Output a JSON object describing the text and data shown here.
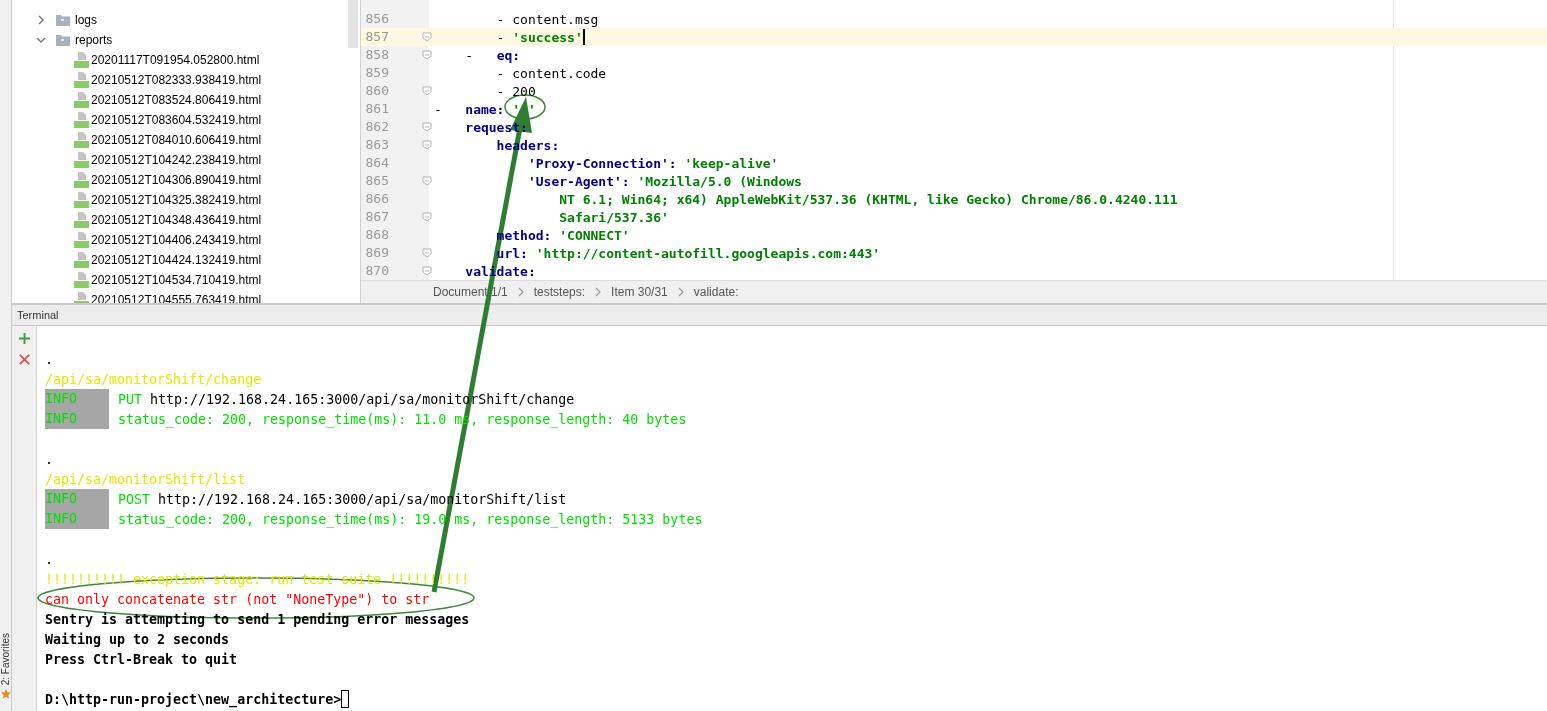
{
  "project_tree": {
    "items": [
      {
        "label": "logs",
        "kind": "folder",
        "expanded": false
      },
      {
        "label": "reports",
        "kind": "folder",
        "expanded": true,
        "children": [
          {
            "label": "20201117T091954.052800.html",
            "kind": "file"
          },
          {
            "label": "20210512T082333.938419.html",
            "kind": "file"
          },
          {
            "label": "20210512T083524.806419.html",
            "kind": "file"
          },
          {
            "label": "20210512T083604.532419.html",
            "kind": "file"
          },
          {
            "label": "20210512T084010.606419.html",
            "kind": "file"
          },
          {
            "label": "20210512T104242.238419.html",
            "kind": "file"
          },
          {
            "label": "20210512T104306.890419.html",
            "kind": "file"
          },
          {
            "label": "20210512T104325.382419.html",
            "kind": "file"
          },
          {
            "label": "20210512T104348.436419.html",
            "kind": "file"
          },
          {
            "label": "20210512T104406.243419.html",
            "kind": "file"
          },
          {
            "label": "20210512T104424.132419.html",
            "kind": "file"
          },
          {
            "label": "20210512T104534.710419.html",
            "kind": "file"
          },
          {
            "label": "20210512T104555.763419.html",
            "kind": "file"
          }
        ]
      }
    ]
  },
  "editor": {
    "lines": [
      {
        "number": "856",
        "fold": false,
        "current": false,
        "segments": [
          {
            "kind": "plain",
            "text": "        - content.msg"
          }
        ]
      },
      {
        "number": "857",
        "fold": true,
        "current": true,
        "cursor": true,
        "segments": [
          {
            "kind": "plain",
            "text": "        - "
          },
          {
            "kind": "string",
            "text": "'success'"
          }
        ]
      },
      {
        "number": "858",
        "fold": true,
        "current": false,
        "segments": [
          {
            "kind": "plain",
            "text": "    -   "
          },
          {
            "kind": "key",
            "text": "eq:"
          }
        ]
      },
      {
        "number": "859",
        "fold": false,
        "current": false,
        "segments": [
          {
            "kind": "plain",
            "text": "        - content.code"
          }
        ]
      },
      {
        "number": "860",
        "fold": true,
        "current": false,
        "segments": [
          {
            "kind": "plain",
            "text": "        - 200"
          }
        ]
      },
      {
        "number": "861",
        "fold": false,
        "current": false,
        "segments": [
          {
            "kind": "plain",
            "text": "-   "
          },
          {
            "kind": "key",
            "text": "name: "
          },
          {
            "kind": "string",
            "text": "' '"
          }
        ]
      },
      {
        "number": "862",
        "fold": true,
        "current": false,
        "segments": [
          {
            "kind": "key",
            "text": "    request:"
          }
        ]
      },
      {
        "number": "863",
        "fold": true,
        "current": false,
        "segments": [
          {
            "kind": "key",
            "text": "        headers:"
          }
        ]
      },
      {
        "number": "864",
        "fold": false,
        "current": false,
        "segments": [
          {
            "kind": "key",
            "text": "            'Proxy-Connection': "
          },
          {
            "kind": "string",
            "text": "'keep-alive'"
          }
        ]
      },
      {
        "number": "865",
        "fold": true,
        "current": false,
        "segments": [
          {
            "kind": "key",
            "text": "            'User-Agent': "
          },
          {
            "kind": "string",
            "text": "'Mozilla/5.0 (Windows"
          }
        ]
      },
      {
        "number": "866",
        "fold": false,
        "current": false,
        "segments": [
          {
            "kind": "string",
            "text": "                NT 6.1; Win64; x64) AppleWebKit/537.36 (KHTML, like Gecko) Chrome/86.0.4240.111"
          }
        ]
      },
      {
        "number": "867",
        "fold": true,
        "current": false,
        "segments": [
          {
            "kind": "string",
            "text": "                Safari/537.36'"
          }
        ]
      },
      {
        "number": "868",
        "fold": false,
        "current": false,
        "segments": [
          {
            "kind": "key",
            "text": "        method: "
          },
          {
            "kind": "string",
            "text": "'CONNECT'"
          }
        ]
      },
      {
        "number": "869",
        "fold": true,
        "current": false,
        "segments": [
          {
            "kind": "key",
            "text": "        url: "
          },
          {
            "kind": "string",
            "text": "'http://content-autofill.googleapis.com:443'"
          }
        ]
      },
      {
        "number": "870",
        "fold": true,
        "current": false,
        "segments": [
          {
            "kind": "key",
            "text": "    validate:"
          }
        ]
      }
    ],
    "breadcrumb": [
      "Document 1/1",
      "teststeps:",
      "Item 30/31",
      "validate:"
    ]
  },
  "terminal": {
    "title": "Terminal",
    "lines": [
      {
        "kind": "blank"
      },
      {
        "kind": "plain",
        "text": "."
      },
      {
        "kind": "path",
        "text": "/api/sa/monitorShift/change"
      },
      {
        "kind": "info",
        "label": "INFO",
        "segments": [
          {
            "kind": "green",
            "text": "PUT"
          },
          {
            "kind": "plain",
            "text": " http://192.168.24.165:3000/api/sa/monitorShift/change"
          }
        ]
      },
      {
        "kind": "info",
        "label": "INFO",
        "segments": [
          {
            "kind": "green",
            "text": "status_code: 200, response_time(ms): 11.0 ms, response_length: 40 bytes"
          }
        ]
      },
      {
        "kind": "blank"
      },
      {
        "kind": "plain",
        "text": "."
      },
      {
        "kind": "path",
        "text": "/api/sa/monitorShift/list"
      },
      {
        "kind": "info",
        "label": "INFO",
        "segments": [
          {
            "kind": "green",
            "text": "POST"
          },
          {
            "kind": "plain",
            "text": " http://192.168.24.165:3000/api/sa/monitorShift/list"
          }
        ]
      },
      {
        "kind": "info",
        "label": "INFO",
        "segments": [
          {
            "kind": "green",
            "text": "status_code: 200, response_time(ms): 19.0 ms, response_length: 5133 bytes"
          }
        ]
      },
      {
        "kind": "blank"
      },
      {
        "kind": "plain",
        "text": "."
      },
      {
        "kind": "path",
        "text": "!!!!!!!!!! exception stage: run test suite !!!!!!!!!!"
      },
      {
        "kind": "error",
        "text": "can only concatenate str (not \"NoneType\") to str"
      },
      {
        "kind": "bold",
        "text": "Sentry is attempting to send 1 pending error messages"
      },
      {
        "kind": "bold",
        "text": "Waiting up to 2 seconds"
      },
      {
        "kind": "bold",
        "text": "Press Ctrl-Break to quit"
      },
      {
        "kind": "blank"
      },
      {
        "kind": "prompt",
        "text": "D:\\http-run-project\\new_architecture>",
        "cursor": true
      }
    ]
  },
  "favorites": {
    "label": "2: Favorites"
  }
}
